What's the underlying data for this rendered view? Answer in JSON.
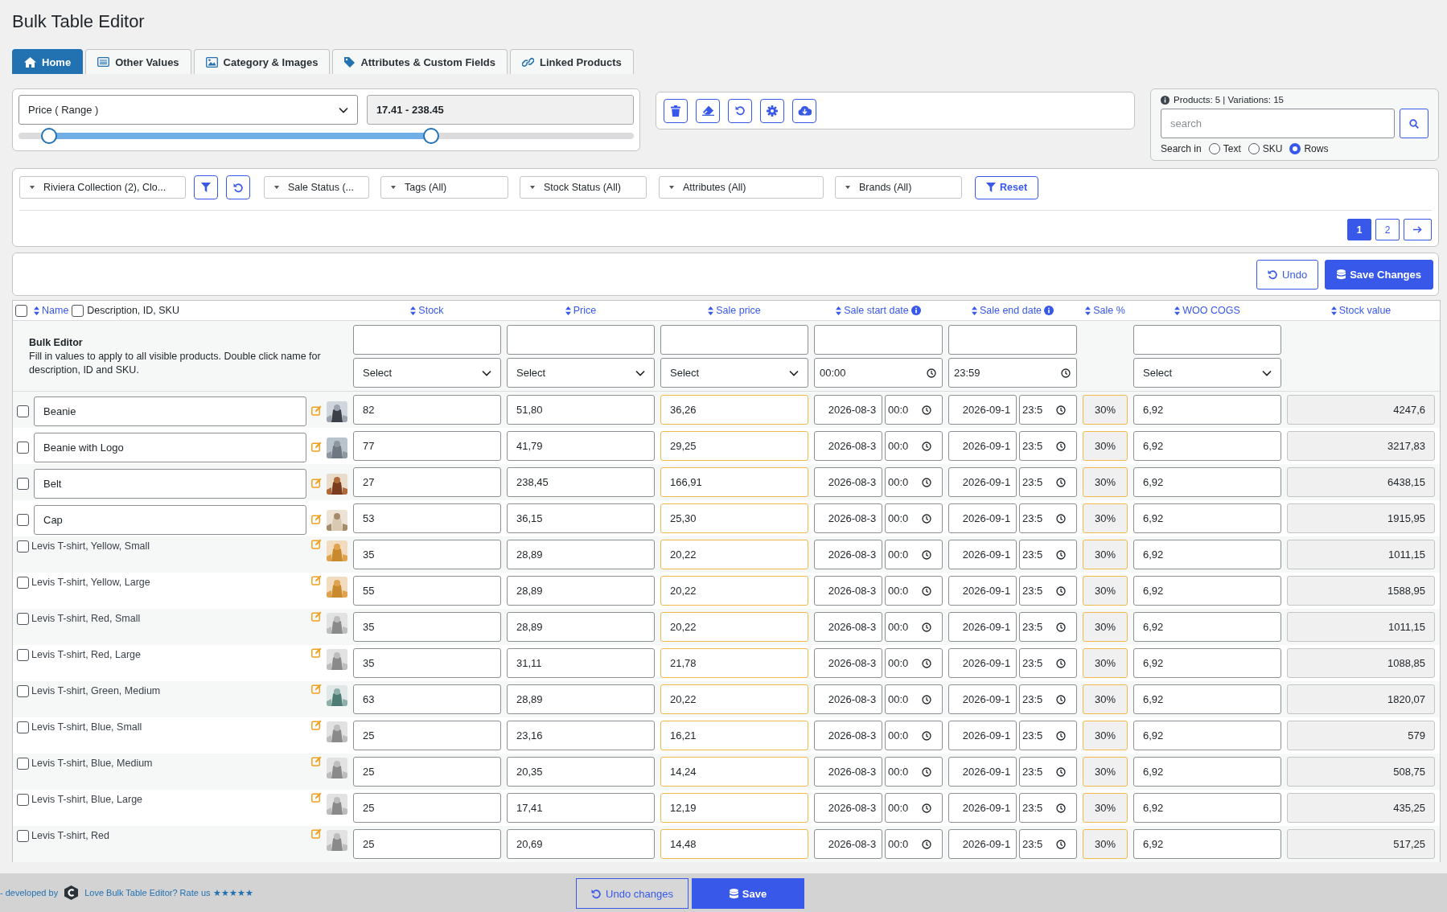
{
  "page_title": "Bulk Table Editor",
  "tabs": [
    {
      "label": "Home",
      "selected": true
    },
    {
      "label": "Other Values",
      "selected": false
    },
    {
      "label": "Category & Images",
      "selected": false
    },
    {
      "label": "Attributes & Custom Fields",
      "selected": false
    },
    {
      "label": "Linked Products",
      "selected": false
    }
  ],
  "range_filter": {
    "field": "Price ( Range )",
    "value": "17.41 - 238.45",
    "thumbs": [
      {
        "level": 0.05
      },
      {
        "level": 0.67
      }
    ]
  },
  "search": {
    "summary": "Products: 5 | Variations: 15",
    "placeholder": "search",
    "search_in": "Search in",
    "options": [
      {
        "label": "Text",
        "selected": false
      },
      {
        "label": "SKU",
        "selected": false
      },
      {
        "label": "Rows",
        "selected": true
      }
    ]
  },
  "filters": {
    "dropdowns": [
      "Riviera Collection  (2), Clo...",
      "Sale Status (...",
      "Tags (All)",
      "Stock Status (All)",
      "Attributes (All)",
      "Brands (All)"
    ],
    "reset": "Reset"
  },
  "pagination": {
    "pages": [
      {
        "label": "1",
        "selected": true
      },
      {
        "label": "2",
        "selected": false
      }
    ]
  },
  "actions": {
    "undo": "Undo",
    "save": "Save Changes"
  },
  "table": {
    "select_all_checked": false,
    "name_header": "Name",
    "description_toggle": {
      "label": "Description, ID, SKU",
      "checked": false
    },
    "columns": [
      {
        "label": "Stock",
        "info": false
      },
      {
        "label": "Price",
        "info": false
      },
      {
        "label": "Sale price",
        "info": false
      },
      {
        "label": "Sale start date",
        "info": true
      },
      {
        "label": "Sale end date",
        "info": true
      },
      {
        "label": "Sale %",
        "info": false
      },
      {
        "label": "WOO COGS",
        "info": false
      },
      {
        "label": "Stock value",
        "info": false
      }
    ],
    "bulk_editor": {
      "title": "Bulk Editor",
      "hint": "Fill in values to apply to all visible products. Double click name for description, ID and SKU.",
      "fields": [
        {
          "kind": "input_select",
          "select": "Select"
        },
        {
          "kind": "input_select",
          "select": "Select"
        },
        {
          "kind": "input_select",
          "select": "Select"
        },
        {
          "kind": "input_time",
          "time": "00:00"
        },
        {
          "kind": "input_time",
          "time": "23:59"
        },
        {
          "kind": "empty"
        },
        {
          "kind": "input_select",
          "select": "Select"
        },
        {
          "kind": "empty"
        }
      ]
    },
    "rows": [
      {
        "kind": "product",
        "name": "Beanie",
        "checked": false,
        "stock": "82",
        "price": "51,80",
        "sale_price": "36,26",
        "start_date": "2026-08-3",
        "start_time": "00:0",
        "end_date": "2026-09-1",
        "end_time": "23:5",
        "sale_pct": "30%",
        "cogs": "6,92",
        "stock_value": "4247,6"
      },
      {
        "kind": "product",
        "name": "Beanie with Logo",
        "checked": false,
        "stock": "77",
        "price": "41,79",
        "sale_price": "29,25",
        "start_date": "2026-08-3",
        "start_time": "00:0",
        "end_date": "2026-09-1",
        "end_time": "23:5",
        "sale_pct": "30%",
        "cogs": "6,92",
        "stock_value": "3217,83"
      },
      {
        "kind": "product",
        "name": "Belt",
        "checked": false,
        "stock": "27",
        "price": "238,45",
        "sale_price": "166,91",
        "start_date": "2026-08-3",
        "start_time": "00:0",
        "end_date": "2026-09-1",
        "end_time": "23:5",
        "sale_pct": "30%",
        "cogs": "6,92",
        "stock_value": "6438,15"
      },
      {
        "kind": "product",
        "name": "Cap",
        "checked": false,
        "stock": "53",
        "price": "36,15",
        "sale_price": "25,30",
        "start_date": "2026-08-3",
        "start_time": "00:0",
        "end_date": "2026-09-1",
        "end_time": "23:5",
        "sale_pct": "30%",
        "cogs": "6,92",
        "stock_value": "1915,95"
      },
      {
        "kind": "variation",
        "name": "Levis T-shirt, Yellow, Small",
        "checked": false,
        "stock": "35",
        "price": "28,89",
        "sale_price": "20,22",
        "start_date": "2026-08-3",
        "start_time": "00:0",
        "end_date": "2026-09-1",
        "end_time": "23:5",
        "sale_pct": "30%",
        "cogs": "6,92",
        "stock_value": "1011,15"
      },
      {
        "kind": "variation",
        "name": "Levis T-shirt, Yellow, Large",
        "checked": false,
        "stock": "55",
        "price": "28,89",
        "sale_price": "20,22",
        "start_date": "2026-08-3",
        "start_time": "00:0",
        "end_date": "2026-09-1",
        "end_time": "23:5",
        "sale_pct": "30%",
        "cogs": "6,92",
        "stock_value": "1588,95"
      },
      {
        "kind": "variation",
        "name": "Levis T-shirt, Red, Small",
        "checked": false,
        "stock": "35",
        "price": "28,89",
        "sale_price": "20,22",
        "start_date": "2026-08-3",
        "start_time": "00:0",
        "end_date": "2026-09-1",
        "end_time": "23:5",
        "sale_pct": "30%",
        "cogs": "6,92",
        "stock_value": "1011,15"
      },
      {
        "kind": "variation",
        "name": "Levis T-shirt, Red, Large",
        "checked": false,
        "stock": "35",
        "price": "31,11",
        "sale_price": "21,78",
        "start_date": "2026-08-3",
        "start_time": "00:0",
        "end_date": "2026-09-1",
        "end_time": "23:5",
        "sale_pct": "30%",
        "cogs": "6,92",
        "stock_value": "1088,85"
      },
      {
        "kind": "variation",
        "name": "Levis T-shirt, Green, Medium",
        "checked": false,
        "stock": "63",
        "price": "28,89",
        "sale_price": "20,22",
        "start_date": "2026-08-3",
        "start_time": "00:0",
        "end_date": "2026-09-1",
        "end_time": "23:5",
        "sale_pct": "30%",
        "cogs": "6,92",
        "stock_value": "1820,07"
      },
      {
        "kind": "variation",
        "name": "Levis T-shirt, Blue, Small",
        "checked": false,
        "stock": "25",
        "price": "23,16",
        "sale_price": "16,21",
        "start_date": "2026-08-3",
        "start_time": "00:0",
        "end_date": "2026-09-1",
        "end_time": "23:5",
        "sale_pct": "30%",
        "cogs": "6,92",
        "stock_value": "579"
      },
      {
        "kind": "variation",
        "name": "Levis T-shirt, Blue, Medium",
        "checked": false,
        "stock": "25",
        "price": "20,35",
        "sale_price": "14,24",
        "start_date": "2026-08-3",
        "start_time": "00:0",
        "end_date": "2026-09-1",
        "end_time": "23:5",
        "sale_pct": "30%",
        "cogs": "6,92",
        "stock_value": "508,75"
      },
      {
        "kind": "variation",
        "name": "Levis T-shirt, Blue, Large",
        "checked": false,
        "stock": "25",
        "price": "17,41",
        "sale_price": "12,19",
        "start_date": "2026-08-3",
        "start_time": "00:0",
        "end_date": "2026-09-1",
        "end_time": "23:5",
        "sale_pct": "30%",
        "cogs": "6,92",
        "stock_value": "435,25"
      },
      {
        "kind": "variation",
        "name": "Levis T-shirt, Red",
        "checked": false,
        "stock": "25",
        "price": "20,69",
        "sale_price": "14,48",
        "start_date": "2026-08-3",
        "start_time": "00:0",
        "end_date": "2026-09-1",
        "end_time": "23:5",
        "sale_pct": "30%",
        "cogs": "6,92",
        "stock_value": "517,25"
      }
    ]
  },
  "footer": {
    "credit": "- developed by",
    "rate_link": "Love Bulk Table Editor? Rate us ★★★★★",
    "undo": "Undo changes",
    "save": "Save"
  }
}
